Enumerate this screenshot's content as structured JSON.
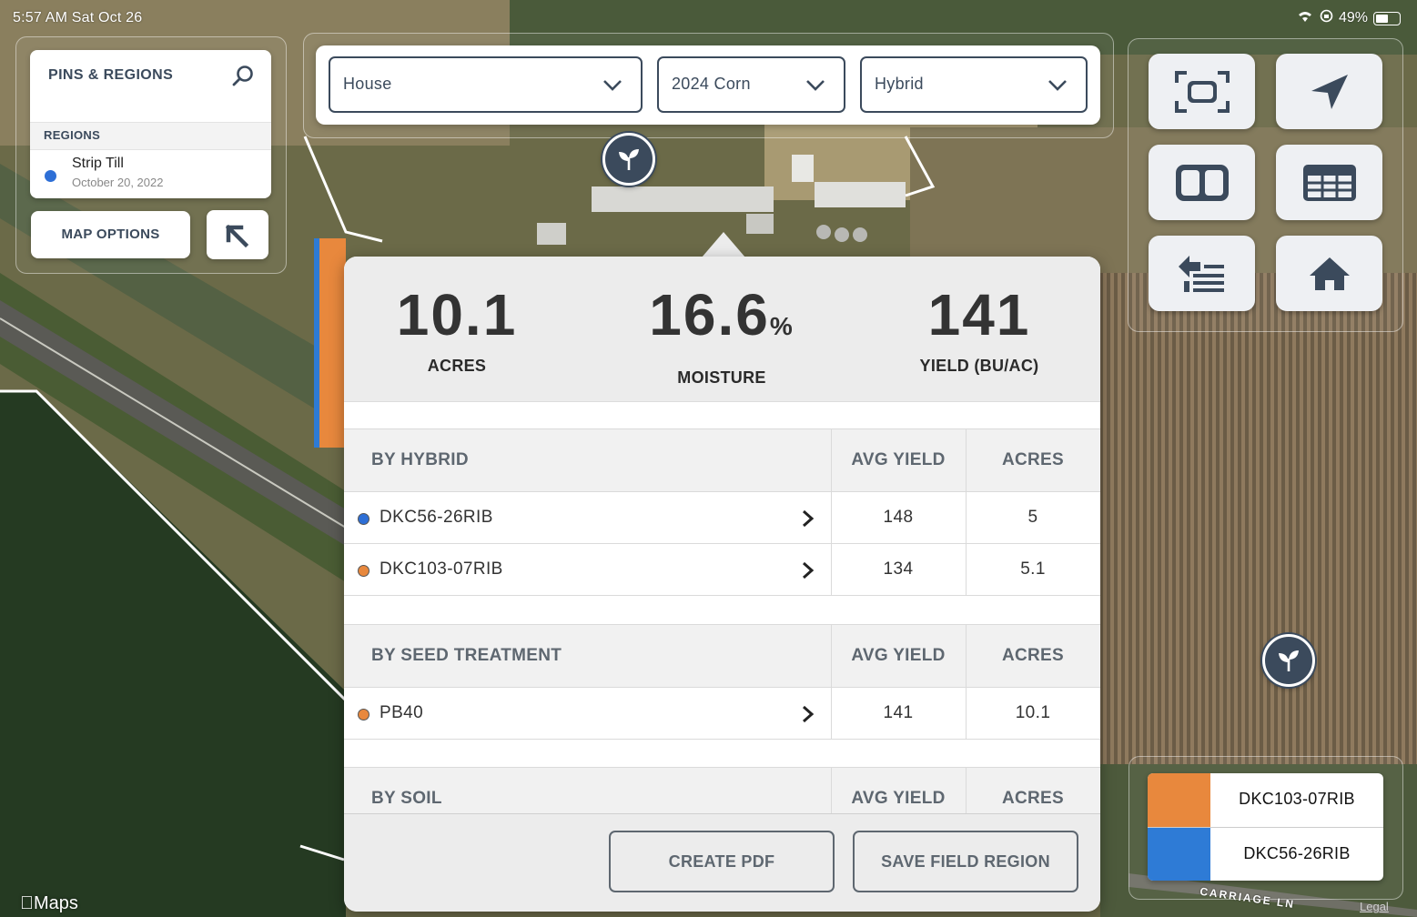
{
  "status_bar": {
    "time_date": "5:57 AM   Sat Oct 26",
    "battery": "49%"
  },
  "pins_regions": {
    "title": "PINS & REGIONS",
    "search_icon": "search-icon",
    "regions_label": "REGIONS",
    "regions": [
      {
        "name": "Strip Till",
        "date": "October 20, 2022",
        "color": "#2e6fd6"
      }
    ],
    "map_options_label": "MAP OPTIONS",
    "collapse_icon": "arrow-up-left-icon"
  },
  "filters": {
    "farm": "House",
    "season": "2024 Corn",
    "layer": "Hybrid"
  },
  "toolbar": {
    "buttons": [
      "fullscreen-icon",
      "location-arrow-icon",
      "split-view-icon",
      "table-icon",
      "layers-list-icon",
      "home-icon"
    ]
  },
  "summary": {
    "acres": {
      "value": "10.1",
      "label": "ACRES"
    },
    "moisture": {
      "value": "16.6",
      "unit": "%",
      "label": "MOISTURE"
    },
    "yield": {
      "value": "141",
      "label": "YIELD (BU/AC)"
    }
  },
  "tables": {
    "avg_yield_label": "AVG YIELD",
    "acres_label": "ACRES",
    "by_hybrid": {
      "title": "BY HYBRID",
      "rows": [
        {
          "name": "DKC56-26RIB",
          "avg_yield": "148",
          "acres": "5",
          "dot_color": "#2e6fd6"
        },
        {
          "name": "DKC103-07RIB",
          "avg_yield": "134",
          "acres": "5.1",
          "dot_color": "#e8883d"
        }
      ]
    },
    "by_seed_treatment": {
      "title": "BY SEED TREATMENT",
      "rows": [
        {
          "name": "PB40",
          "avg_yield": "141",
          "acres": "10.1",
          "dot_color": "#e8883d"
        }
      ]
    },
    "by_soil": {
      "title": "BY SOIL"
    }
  },
  "footer": {
    "create_pdf": "CREATE PDF",
    "save_region": "SAVE FIELD REGION"
  },
  "legend": {
    "items": [
      {
        "name": "DKC103-07RIB",
        "color": "#e8883d"
      },
      {
        "name": "DKC56-26RIB",
        "color": "#2e7bd6"
      }
    ]
  },
  "map": {
    "credit": "Maps",
    "legal": "Legal",
    "street": "CARRIAGE LN"
  },
  "colors": {
    "primary": "#3b4a5c",
    "orange": "#e8883d",
    "blue": "#2e6fd6"
  }
}
